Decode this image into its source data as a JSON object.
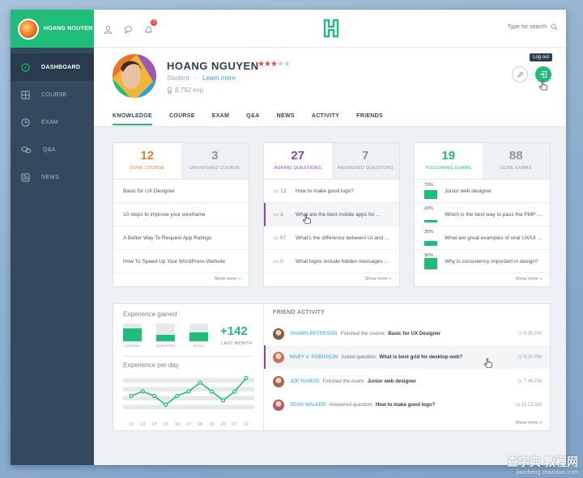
{
  "brand": {
    "user_name": "HOANG NGUYEN"
  },
  "sidebar": {
    "items": [
      {
        "label": "DASHBOARD",
        "icon": "compass-icon",
        "active": true
      },
      {
        "label": "COURSE",
        "icon": "grid-icon"
      },
      {
        "label": "EXAM",
        "icon": "clock-icon"
      },
      {
        "label": "Q&A",
        "icon": "chat-bubbles-icon"
      },
      {
        "label": "NEWS",
        "icon": "rss-icon"
      }
    ]
  },
  "topbar": {
    "notification_count": "2",
    "search_placeholder": "Type for search",
    "accent": "#1fbc7a"
  },
  "profile": {
    "name": "HOANG NGUYEN",
    "rating": 3,
    "rating_max": 5,
    "role": "Student",
    "separator": "•",
    "learn_more": "Learn more",
    "exp": "8,782 exp",
    "logout_tooltip": "Log out"
  },
  "tabs": [
    "KNOWLEDGE",
    "COURSE",
    "EXAM",
    "Q&A",
    "NEWS",
    "ACTIVITY",
    "FRIENDS"
  ],
  "cards": [
    {
      "stats": [
        {
          "num": "12",
          "label": "DONE COURSE",
          "color": "#e67e22"
        },
        {
          "num": "3",
          "label": "UNFINISHED COURSE",
          "color": "#7a8590"
        }
      ],
      "rows": [
        "Basic for UX Designer",
        "10 steps to improve your wireframe",
        "A Better Way To Request App Ratings",
        "How To Speed Up Your WordPress Website"
      ],
      "show_more": "Show more"
    },
    {
      "stats": [
        {
          "num": "27",
          "label": "ASKING QUESTIONS",
          "color": "#8e44ad"
        },
        {
          "num": "7",
          "label": "ANSWERED QUESTIONS",
          "color": "#7a8590"
        }
      ],
      "rows": [
        {
          "count": "12",
          "text": "How to make good logo?"
        },
        {
          "count": "3",
          "text": "What are the best mobile apps for ..."
        },
        {
          "count": "67",
          "text": "What's the difference between UI and ..."
        },
        {
          "count": "0",
          "text": "What logos include hidden messages ..."
        }
      ],
      "show_more": "Show more"
    },
    {
      "stats": [
        {
          "num": "19",
          "label": "FOLLOWING EXAMS",
          "color": "#1fbc7a"
        },
        {
          "num": "88",
          "label": "DONE EXAMS",
          "color": "#7a8590"
        }
      ],
      "rows": [
        {
          "pct": "70%",
          "value": 0.7,
          "text": "Junior web designer"
        },
        {
          "pct": "20%",
          "value": 0.2,
          "text": "Which is the best way to pass the PMP ..."
        },
        {
          "pct": "35%",
          "value": 0.35,
          "text": "What are great examples of viral UX/UI ..."
        },
        {
          "pct": "90%",
          "value": 0.9,
          "text": "Why is consistency important in design?"
        }
      ],
      "show_more": "Show more"
    }
  ],
  "experience": {
    "title": "Experience gained",
    "bars": [
      {
        "label": "COURSE",
        "value": 0.75
      },
      {
        "label": "QUESTION",
        "value": 0.35
      },
      {
        "label": "EXAM",
        "value": 0.5
      }
    ],
    "total": "+142",
    "total_label": "LAST MONTH",
    "per_day_title": "Experience per day"
  },
  "chart_data": {
    "type": "line",
    "title": "Experience per day",
    "x": [
      "12",
      "13",
      "14",
      "15",
      "16",
      "17",
      "18",
      "19",
      "20",
      "21",
      "22"
    ],
    "series": [
      {
        "values": [
          3,
          4,
          3,
          1,
          3,
          4,
          6,
          4,
          2,
          4,
          7
        ]
      }
    ],
    "ylim": [
      0,
      8
    ],
    "color": "#1fbc7a",
    "grid": true
  },
  "activity": {
    "title": "FRIEND ACTIVITY",
    "rows": [
      {
        "name": "SHAWN PETERSON",
        "action": "Finished the course:",
        "subject": "Basic for UX Designer",
        "time": "9:30 PM",
        "avatar": "#7c5c4a"
      },
      {
        "name": "MARY V. ROBINSON",
        "action": "Asked question:",
        "subject": "What is best grid for desktop web?",
        "time": "9:20 PM",
        "avatar": "#c0765f"
      },
      {
        "name": "JOE RAMOS",
        "action": "Finished the exam:",
        "subject": "Junior web designer",
        "time": "7:45 PM",
        "avatar": "#a06a4e"
      },
      {
        "name": "SEAN WALKER",
        "action": "Answered question:",
        "subject": "How to make good logo?",
        "time": "11:15 AM",
        "avatar": "#b35a68"
      }
    ],
    "show_more": "Show more"
  },
  "watermark": {
    "text": "查字典 教程网",
    "url": "jiaocheng.chazidian.com"
  }
}
